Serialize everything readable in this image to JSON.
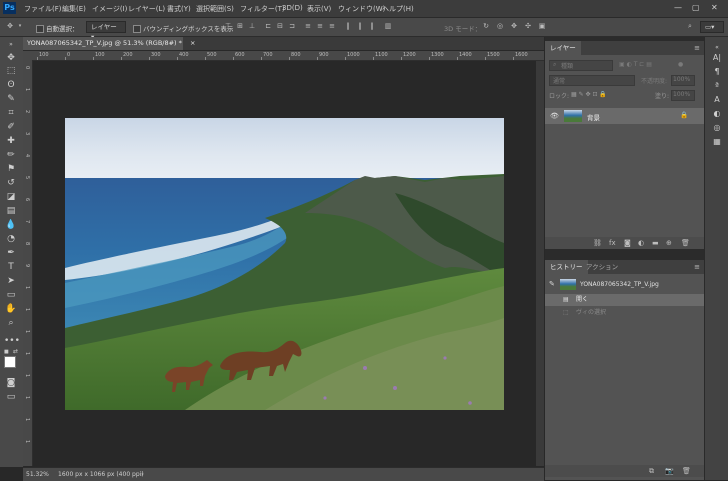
{
  "app": {
    "logo": "Ps"
  },
  "menu": [
    "ファイル(F)",
    "編集(E)",
    "イメージ(I)",
    "レイヤー(L)",
    "書式(Y)",
    "選択範囲(S)",
    "フィルター(T)",
    "3D(D)",
    "表示(V)",
    "ウィンドウ(W)",
    "ヘルプ(H)"
  ],
  "options": {
    "auto_select_label": "自動選択：",
    "auto_select_value": "レイヤー",
    "bounding_box_label": "バウンディングボックスを表示",
    "mode3d_label": "3D モード："
  },
  "document": {
    "tab_title": "YONA087065342_TP_V.jpg @ 51.3% (RGB/8#) *",
    "close_glyph": "×"
  },
  "ruler": {
    "h": [
      "100",
      "0",
      "100",
      "200",
      "300",
      "400",
      "500",
      "600",
      "700",
      "800",
      "900",
      "1000",
      "1100",
      "1200",
      "1300",
      "1400",
      "1500",
      "1600"
    ],
    "v": [
      "0",
      "1",
      "2",
      "3",
      "4",
      "5",
      "6",
      "7",
      "8",
      "9",
      "1",
      "1",
      "1",
      "1",
      "1",
      "1",
      "1",
      "1"
    ]
  },
  "status": {
    "zoom": "51.32%",
    "doc_info": "1600 px x 1066 px (400 ppi)",
    "arrow": "›"
  },
  "layers_panel": {
    "tab": "レイヤー",
    "search_kind": "種類",
    "blend_mode": "通常",
    "opacity_label": "不透明度:",
    "opacity_value": "100%",
    "lock_label": "ロック:",
    "fill_label": "塗り:",
    "fill_value": "100%",
    "layer_name": "背景",
    "footer_icons": [
      "link-icon",
      "fx-icon",
      "mask-icon",
      "adjustment-icon",
      "folder-icon",
      "new-layer-icon",
      "trash-icon"
    ]
  },
  "history_panel": {
    "tabs": [
      "ヒストリー",
      "アクション"
    ],
    "snapshot": "YONA087065342_TP_V.jpg",
    "items": [
      "開く",
      "ヴィの選択"
    ]
  },
  "colors": {
    "accent_blue": "#31a8ff",
    "panel": "#535353",
    "selected_row": "#6a6a6a"
  }
}
